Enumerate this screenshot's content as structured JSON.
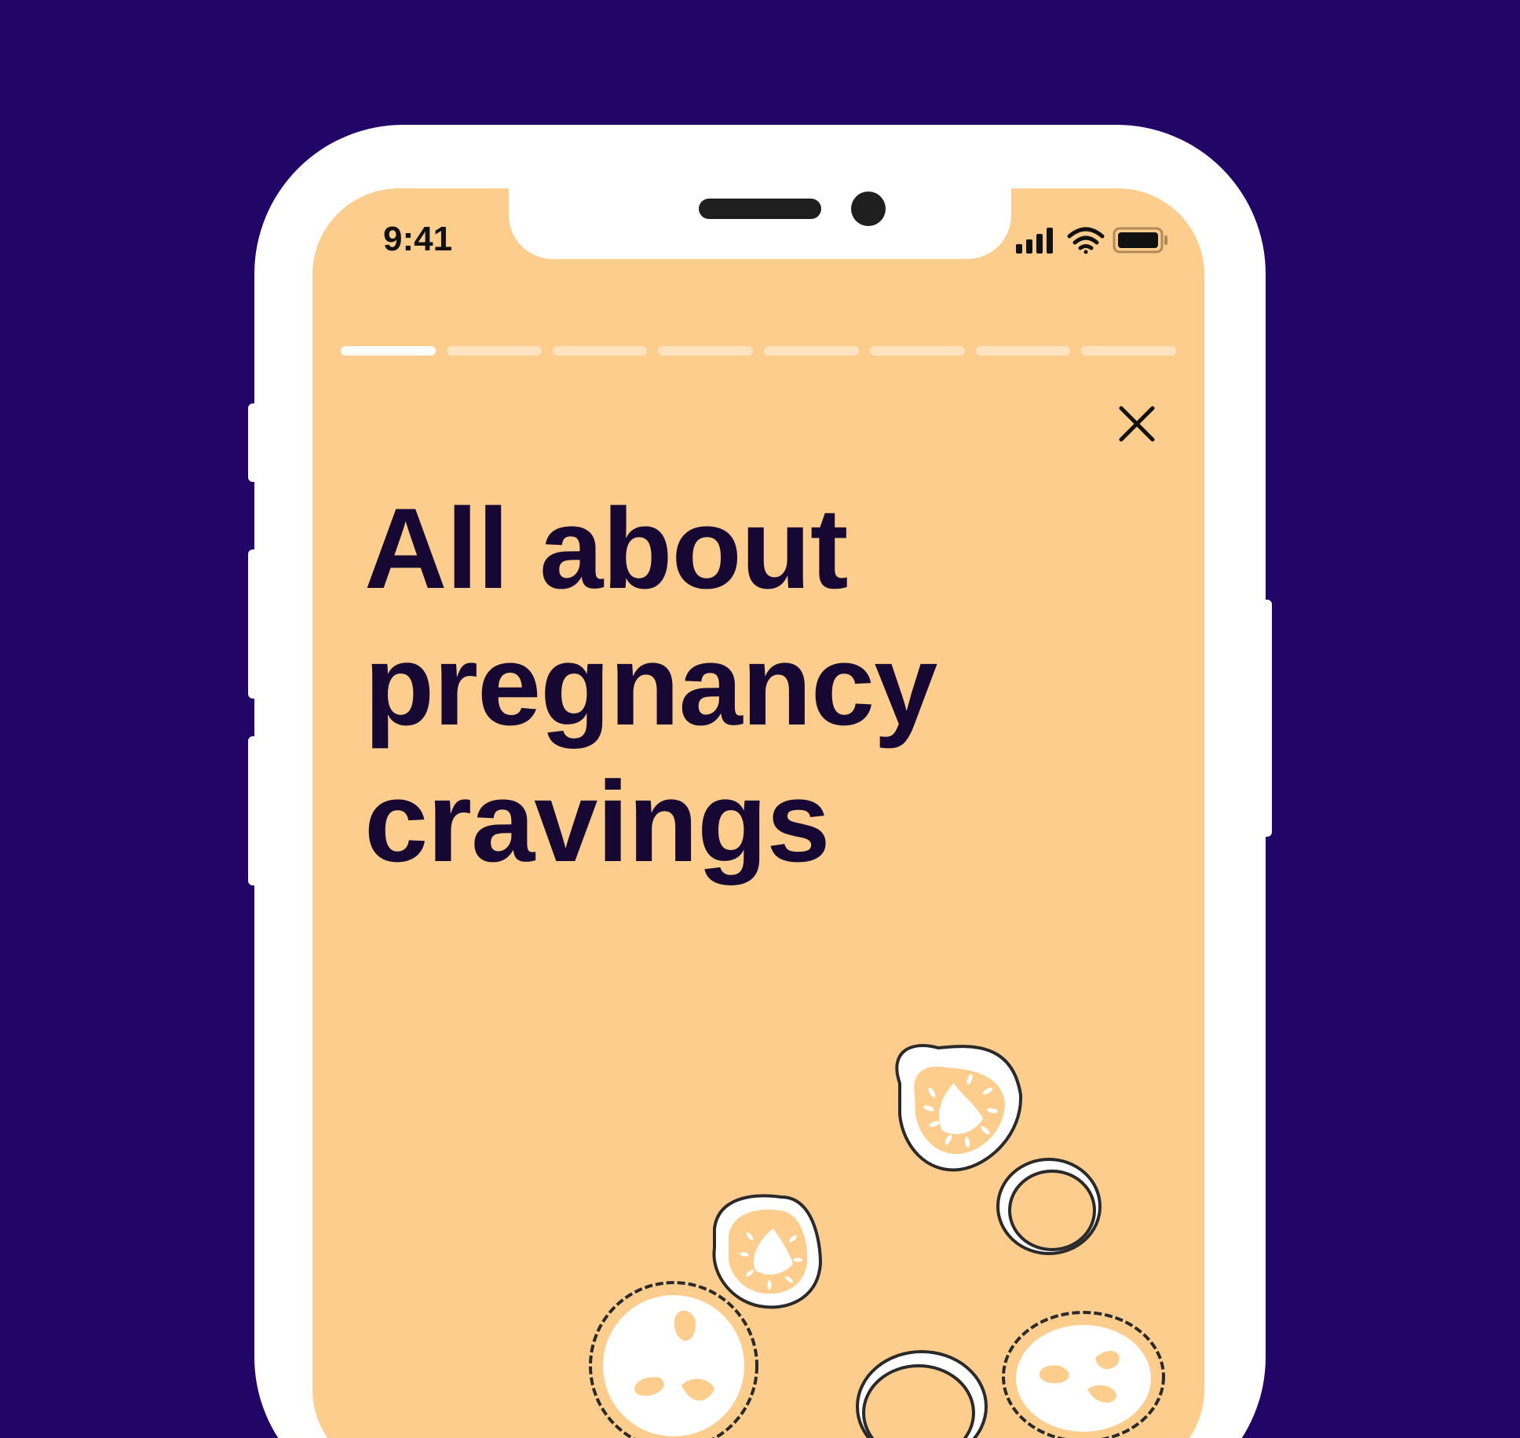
{
  "colors": {
    "background": "#210567",
    "screen": "#fdcd8d",
    "headline": "#160833",
    "frame": "#ffffff"
  },
  "status_bar": {
    "time": "9:41",
    "icons": [
      "cellular-signal-icon",
      "wifi-icon",
      "battery-icon"
    ]
  },
  "story": {
    "segments_total": 8,
    "segment_active": 1,
    "headline_lines": [
      "All about",
      "pregnancy",
      "cravings"
    ]
  },
  "close": {
    "icon": "close-icon"
  },
  "illustration": {
    "items": [
      "cucumber-slice-icon",
      "cucumber-slice-icon",
      "onion-ring-icon",
      "onion-ring-icon",
      "lemon-slice-icon",
      "lemon-slice-icon"
    ]
  }
}
